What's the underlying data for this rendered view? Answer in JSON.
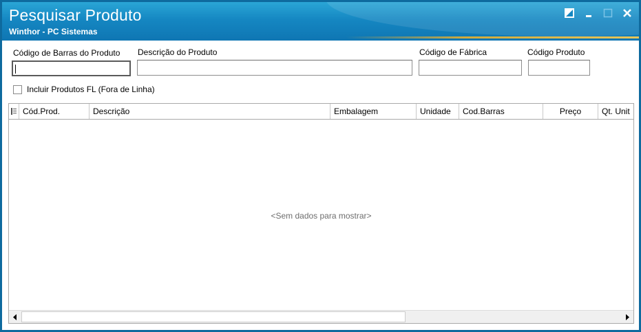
{
  "window": {
    "title": "Pesquisar Produto",
    "subtitle": "Winthor - PC Sistemas",
    "controls": [
      "restore-icon",
      "minimize-icon",
      "maximize-icon",
      "close-icon"
    ]
  },
  "filters": {
    "barcode": {
      "label": "Código de Barras do Produto",
      "value": ""
    },
    "description": {
      "label": "Descrição do Produto",
      "value": ""
    },
    "factory_code": {
      "label": "Código de Fábrica",
      "value": ""
    },
    "product_code": {
      "label": "Código Produto",
      "value": ""
    },
    "include_fl": {
      "label": "Incluir Produtos FL (Fora de Linha)",
      "checked": false
    }
  },
  "grid": {
    "columns": [
      "Cód.Prod.",
      "Descrição",
      "Embalagem",
      "Unidade",
      "Cod.Barras",
      "Preço",
      "Qt. Unit"
    ],
    "empty_text": "<Sem dados para mostrar>",
    "rows": []
  },
  "colors": {
    "titlebar": "#1587c2",
    "frame": "#0e6a9e",
    "accent_line": "#d1aa3c"
  }
}
